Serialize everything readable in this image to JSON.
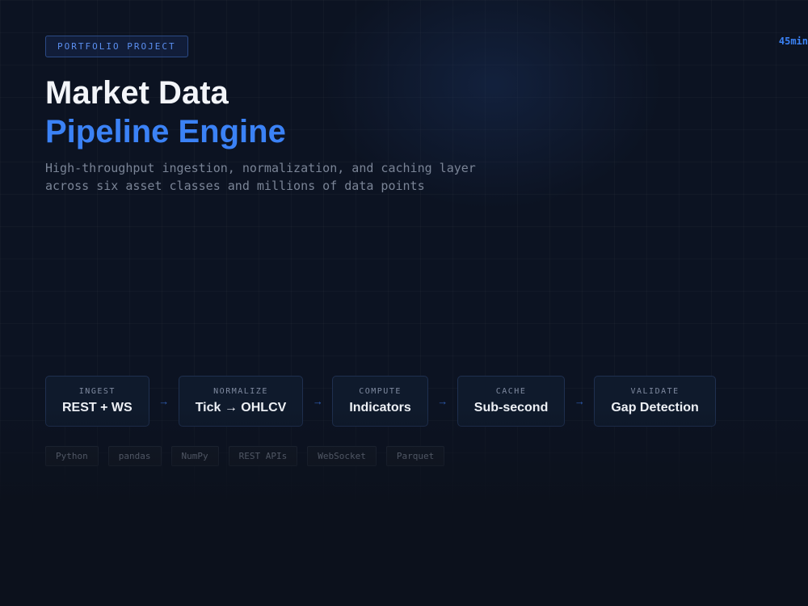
{
  "badge": "PORTFOLIO PROJECT",
  "timer": "45min",
  "title": {
    "line1": "Market Data",
    "line2": "Pipeline Engine"
  },
  "subtitle": {
    "line1": "High-throughput ingestion, normalization, and caching layer",
    "line2": "across six asset classes and millions of data points"
  },
  "pipeline": {
    "arrow": "→",
    "stages": [
      {
        "label": "INGEST",
        "value": "REST + WS"
      },
      {
        "label": "NORMALIZE",
        "value": "Tick → OHLCV"
      },
      {
        "label": "COMPUTE",
        "value": "Indicators"
      },
      {
        "label": "CACHE",
        "value": "Sub-second"
      },
      {
        "label": "VALIDATE",
        "value": "Gap Detection"
      }
    ]
  },
  "tech_tags": [
    "Python",
    "pandas",
    "NumPy",
    "REST APIs",
    "WebSocket",
    "Parquet"
  ],
  "colors": {
    "background": "#0c111c",
    "accent": "#3b82f6",
    "title": "#f3f5f9",
    "muted": "#7a8496"
  }
}
